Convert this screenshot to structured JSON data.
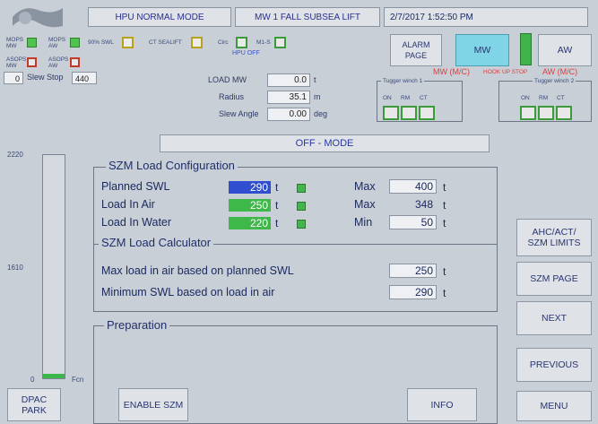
{
  "header": {
    "mode": "HPU NORMAL MODE",
    "lift": "MW 1 FALL SUBSEA LIFT",
    "datetime": "2/7/2017 1:52:50 PM"
  },
  "indicators": {
    "mops_mw": "MOPS MW",
    "mops_aw": "MOPS AW",
    "swl_90": "90% SWL",
    "ct_sealift": "CT SEALIFT",
    "circ": "Circ",
    "m1s": "M1-S",
    "hpu_off": "HPU OFF",
    "asops_mw": "ASOPS MW",
    "asops_aw": "ASOPS AW"
  },
  "slew": {
    "left_value": "0",
    "label": "Slew Stop",
    "right_value": "440"
  },
  "load_info": {
    "load_label": "LOAD MW",
    "load_value": "0.0",
    "load_unit": "t",
    "radius_label": "Radius",
    "radius_value": "35.1",
    "radius_unit": "m",
    "slew_label": "Slew Angle",
    "slew_value": "0.00",
    "slew_unit": "deg"
  },
  "alarm_button": "ALARM PAGE",
  "mw_button": "MW",
  "aw_button": "AW",
  "hookup_status": {
    "mw": "MW (M/C)",
    "middle": "HOOK UP STOP",
    "aw": "AW (M/C)"
  },
  "tugger1": {
    "title": "Tugger winch 1",
    "on": "ON",
    "rm": "RM",
    "ct": "CT"
  },
  "tugger2": {
    "title": "Tugger winch 2",
    "on": "ON",
    "rm": "RM",
    "ct": "CT"
  },
  "mode_banner": "OFF - MODE",
  "gauge": {
    "top": "2220",
    "mid": "1610",
    "bottom": "0",
    "unit": "Fcn",
    "level": 0.02
  },
  "szm_config": {
    "title": "SZM Load Configuration",
    "rows": [
      {
        "label": "Planned SWL",
        "value": "290",
        "unit": "t",
        "limit_label": "Max",
        "limit_value": "400",
        "limit_unit": "t"
      },
      {
        "label": "Load In Air",
        "value": "250",
        "unit": "t",
        "limit_label": "Max",
        "limit_value": "348",
        "limit_unit": "t"
      },
      {
        "label": "Load In Water",
        "value": "220",
        "unit": "t",
        "limit_label": "Min",
        "limit_value": "50",
        "limit_unit": "t"
      }
    ]
  },
  "szm_calc": {
    "title": "SZM Load Calculator",
    "rows": [
      {
        "label": "Max load in air based on planned SWL",
        "value": "250",
        "unit": "t"
      },
      {
        "label": "Minimum SWL based on  load in air",
        "value": "290",
        "unit": "t"
      }
    ]
  },
  "preparation": {
    "title": "Preparation"
  },
  "buttons": {
    "ahc": "AHC/ACT/ SZM LIMITS",
    "szm_page": "SZM PAGE",
    "next": "NEXT",
    "previous": "PREVIOUS",
    "menu": "MENU",
    "dpac": "DPAC PARK",
    "enable_szm": "ENABLE SZM",
    "info": "INFO"
  }
}
